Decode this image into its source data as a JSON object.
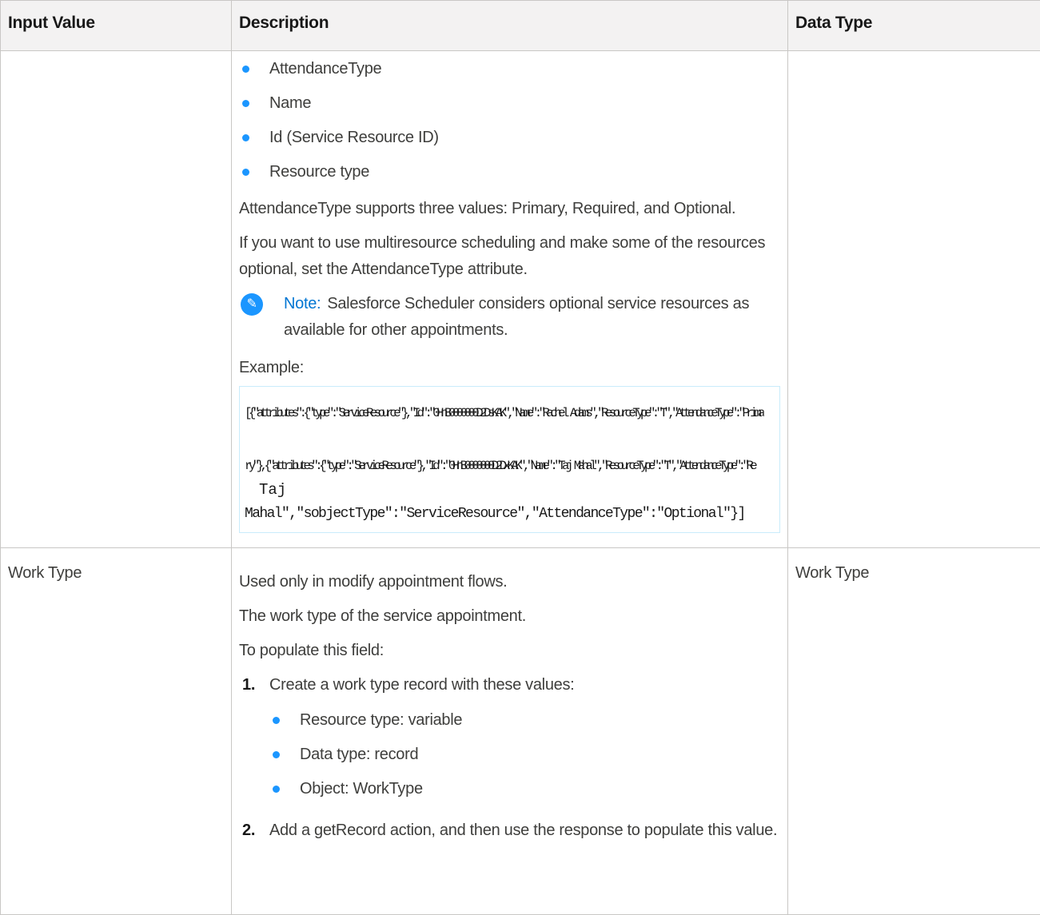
{
  "table": {
    "headers": [
      "Input Value",
      "Description",
      "Data Type"
    ]
  },
  "row1": {
    "bullets": [
      "AttendanceType",
      "Name",
      "Id (Service Resource ID)",
      "Resource type"
    ],
    "para1": "AttendanceType supports three values: Primary, Required, and Optional.",
    "para2": "If you want to use multiresource scheduling and make some of the resources optional, set the AttendanceType attribute.",
    "note_label": "Note:",
    "note_text": "Salesforce Scheduler considers optional service resources as available for other appointments.",
    "example_label": "Example:",
    "code_line1": "[{\"attributes\":{\"type\":\"ServiceResource\"},\"Id\":\"0HnB0000000D2DsKAK\",\"Name\":\"Rachel Adams\",\"ResourceType\":\"T\",\"AttendanceType\":\"Prima",
    "code_line2": "ry\"},{\"attributes\":{\"type\":\"ServiceResource\"},\"Id\":\"0HnB0000000D2DxKAK\",\"Name\":\"Taj Mahal\",\"ResourceType\":\"T\",\"AttendanceType\":\"Re",
    "code_line3": "Taj",
    "code_line4": "Mahal\",\"sobjectType\":\"ServiceResource\",\"AttendanceType\":\"Optional\"}]"
  },
  "row2": {
    "input": "Work Type",
    "data_type": "Work Type",
    "para1": "Used only in modify appointment flows.",
    "para2": "The work type of the service appointment.",
    "para3": "To populate this field:",
    "step1_num": "1.",
    "step1": "Create a work type record with these values:",
    "sub": [
      "Resource type: variable",
      "Data type: record",
      "Object: WorkType"
    ],
    "step2_num": "2.",
    "step2": "Add a getRecord action, and then use the response to populate this value."
  },
  "colors": {
    "bullet": "#1b96ff",
    "note_label": "#0176d3",
    "border": "#c9c7c5",
    "header_bg": "#f3f2f2"
  }
}
